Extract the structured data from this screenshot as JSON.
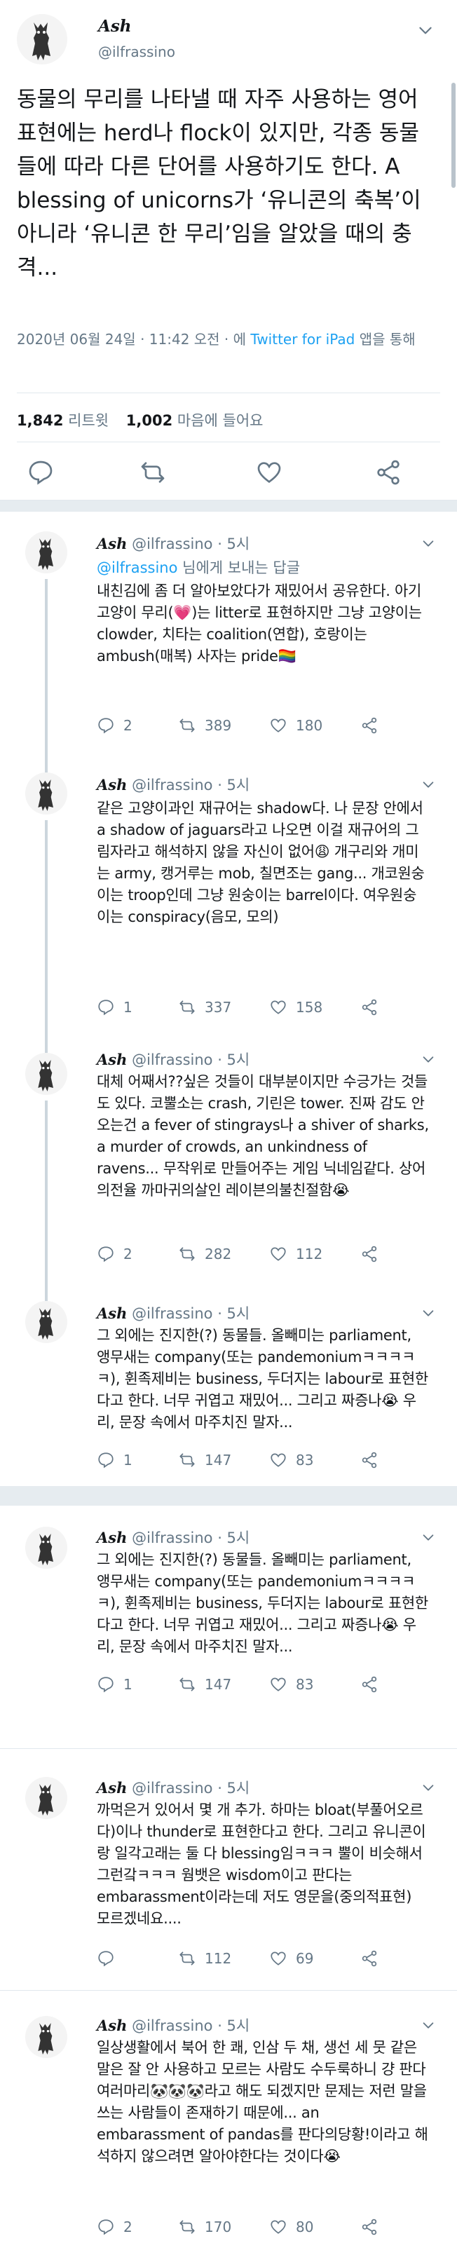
{
  "main": {
    "name": "Ash",
    "handle": "@ilfrassino",
    "text": "동물의 무리를 나타낼 때 자주 사용하는 영어표현에는 herd나 flock이 있지만, 각종 동물들에 따라 다른 단어를 사용하기도 한다. A blessing of unicorns가 ‘유니콘의 축복’이 아니라 ‘유니콘 한 무리’임을 알았을 때의 충격...",
    "timestamp": "2020년 06월 24일 · 11:42 오전 · 에",
    "via_app": "Twitter for iPad",
    "via_suffix": "앱을 통해",
    "retweets_count": "1,842",
    "retweets_label": "리트윗",
    "likes_count": "1,002",
    "likes_label": "마음에 들어요"
  },
  "replies": [
    {
      "name": "Ash",
      "handle": "@ilfrassino · 5시",
      "replying_to": "@ilfrassino",
      "replying_suffix": "님에게 보내는 답글",
      "text": "내친김에 좀 더 알아보았다가 재밌어서 공유한다. 아기고양이 무리(💗)는 litter로 표현하지만 그냥 고양이는 clowder, 치타는 coalition(연합), 호랑이는 ambush(매복) 사자는 pride🏳️‍🌈",
      "replies": "2",
      "retweets": "389",
      "likes": "180"
    },
    {
      "name": "Ash",
      "handle": "@ilfrassino · 5시",
      "text": "같은 고양이과인 재규어는 shadow다. 나 문장 안에서 a shadow of jaguars라고 나오면 이걸 재규어의 그림자라고 해석하지 않을 자신이 없어😩 개구리와 개미는 army, 캥거루는 mob, 칠면조는 gang... 개코원숭이는 troop인데 그냥 원숭이는 barrel이다. 여우원숭이는 conspiracy(음모, 모의)",
      "replies": "1",
      "retweets": "337",
      "likes": "158"
    },
    {
      "name": "Ash",
      "handle": "@ilfrassino · 5시",
      "text": "대체 어째서??싶은 것들이 대부분이지만 수긍가는 것들도 있다. 코뿔소는 crash, 기린은 tower. 진짜 감도 안 오는건 a fever of stingrays나 a shiver of sharks, a murder of crowds, an unkindness of ravens... 무작위로 만들어주는 게임 닉네임같다. 상어의전율 까마귀의살인 레이븐의불친절함😭",
      "replies": "2",
      "retweets": "282",
      "likes": "112"
    },
    {
      "name": "Ash",
      "handle": "@ilfrassino · 5시",
      "text": "그 외에는 진지한(?) 동물들. 올빼미는 parliament, 앵무새는 company(또는 pandemoniumㅋㅋㅋㅋㅋ), 휜족제비는 business, 두더지는 labour로 표현한다고 한다. 너무 귀엽고 재밌어... 그리고 짜증나😭 우리, 문장 속에서 마주치진 말자...",
      "replies": "1",
      "retweets": "147",
      "likes": "83"
    },
    {
      "name": "Ash",
      "handle": "@ilfrassino · 5시",
      "text": "그 외에는 진지한(?) 동물들. 올빼미는 parliament, 앵무새는 company(또는 pandemoniumㅋㅋㅋㅋㅋ), 휜족제비는 business, 두더지는 labour로 표현한다고 한다. 너무 귀엽고 재밌어... 그리고 짜증나😭 우리, 문장 속에서 마주치진 말자...",
      "replies": "1",
      "retweets": "147",
      "likes": "83"
    },
    {
      "name": "Ash",
      "handle": "@ilfrassino · 5시",
      "text": "까먹은거 있어서 몇 개 추가. 하마는 bloat(부풀어오르다)이나 thunder로 표현한다고 한다. 그리고 유니콘이랑 일각고래는 둘 다 blessing임ㅋㅋㅋ 뿔이 비슷해서 그런갘ㅋㅋㅋ 웜뱃은 wisdom이고 판다는 embarassment이라는데 저도 영문을(중의적표현) 모르겠네요....",
      "replies": "",
      "retweets": "112",
      "likes": "69"
    },
    {
      "name": "Ash",
      "handle": "@ilfrassino · 5시",
      "text": "일상생활에서 북어 한 쾌, 인삼 두 채, 생선 세 뭇 같은 말은 잘 안 사용하고 모르는 사람도 수두룩하니 걍 판다 여러마리🐼🐼🐼라고 해도 되겠지만 문제는 저런 말을 쓰는 사람들이 존재하기 때문에... an embarassment of pandas를 판다의당황!이라고 해석하지 않으려면 알아야한다는 것이다😭",
      "replies": "2",
      "retweets": "170",
      "likes": "80"
    }
  ]
}
